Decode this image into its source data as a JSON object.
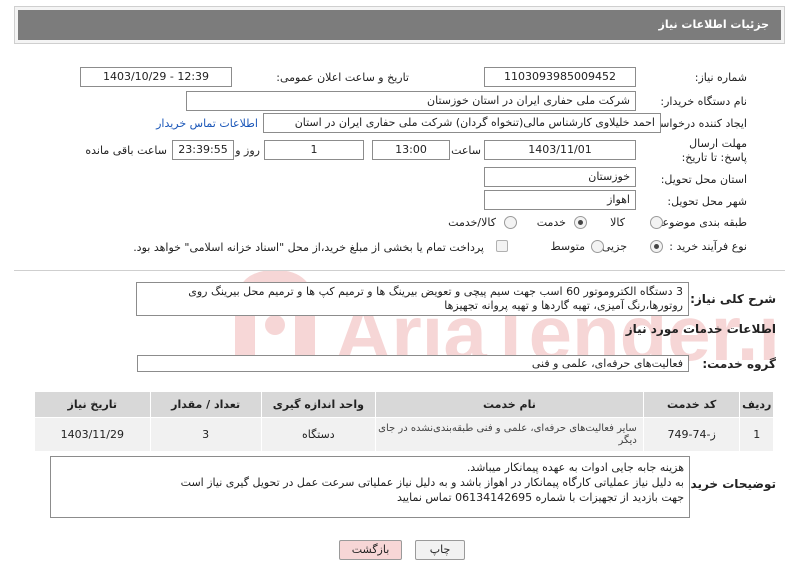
{
  "header": {
    "title": "جزئیات اطلاعات نیاز"
  },
  "form": {
    "need_number_label": "شماره نیاز:",
    "need_number": "1103093985009452",
    "announce_label": "تاریخ و ساعت اعلان عمومی:",
    "announce_value": "1403/10/29 - 12:39",
    "buyer_label": "نام دستگاه خریدار:",
    "buyer_value": "شرکت ملی حفاری ایران در استان خوزستان",
    "creator_label": "ایجاد کننده درخواست:",
    "creator_value": "احمد خلیلاوی کارشناس مالی(تنخواه گردان) شرکت ملی حفاری ایران در استان",
    "contact_link": "اطلاعات تماس خریدار",
    "deadline_label": "مهلت ارسال پاسخ: تا تاریخ:",
    "deadline_date": "1403/11/01",
    "time_label": "ساعت",
    "deadline_time": "13:00",
    "days_value": "1",
    "days_label": "روز و",
    "remaining_value": "23:39:55",
    "remaining_label": "ساعت باقی مانده",
    "province_label": "استان محل تحویل:",
    "province_value": "خوزستان",
    "city_label": "شهر محل تحویل:",
    "city_value": "اهواز",
    "category_label": "طبقه بندی موضوعی:",
    "category_options": [
      "کالا",
      "خدمت",
      "کالا/خدمت"
    ],
    "process_label": "نوع فرآیند خرید :",
    "process_options": [
      "جزیی",
      "متوسط"
    ],
    "payment_note": "پرداخت تمام یا بخشی از مبلغ خرید،از محل \"اسناد خزانه اسلامی\" خواهد بود."
  },
  "summary": {
    "label": "شرح کلی نیاز:",
    "text": "3 دستگاه الکتروموتور 60 اسب جهت سیم پیچی و تعویض بیرینگ ها و ترمیم کپ ها و ترمیم محل بیرینگ روی روتورها،رنگ آمیزی، تهیه گاردها و تهیه پروانه تجهیزها"
  },
  "services": {
    "section_title": "اطلاعات خدمات مورد نیاز",
    "group_label": "گروه خدمت:",
    "group_value": "فعالیت‌های حرفه‌ای، علمی و فنی",
    "columns": [
      "ردیف",
      "کد خدمت",
      "نام خدمت",
      "واحد اندازه گیری",
      "تعداد / مقدار",
      "تاریخ نیاز"
    ],
    "rows": [
      [
        "1",
        "ز-74-749",
        "سایر فعالیت‌های حرفه‌ای، علمی و فنی طبقه‌بندی‌نشده در جای دیگر",
        "دستگاه",
        "3",
        "1403/11/29"
      ]
    ]
  },
  "buyer_notes": {
    "label": "توضیحات خریدار:",
    "lines": [
      "هزینه جابه جایی ادوات به عهده پیمانکار میباشد.",
      "به دلیل نیاز عملیاتی کارگاه پیمانکار در اهواز باشد و به دلیل نیاز عملیاتی سرعت عمل در تحویل گیری نیاز است",
      "جهت بازدید از تجهیزات با شماره 06134142695 تماس نمایید"
    ]
  },
  "buttons": {
    "print": "چاپ",
    "back": "بازگشت"
  },
  "watermark": {
    "text": "AriaTender.neT"
  }
}
